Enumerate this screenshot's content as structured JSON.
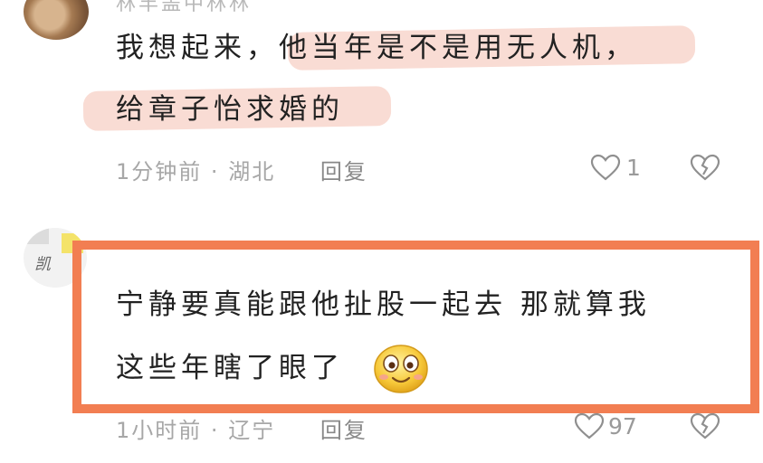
{
  "comments": [
    {
      "author_partial": "林丰盖中林林",
      "text_line1_plain": "我想起来，",
      "text_line1_highlight": "他当年是不是用无人机，",
      "text_line2_highlight": "给章子怡求婚的",
      "time": "1分钟前",
      "separator": "·",
      "location": "湖北",
      "reply_label": "回复",
      "like_count": "1",
      "highlight_color": "#f9dcd4"
    },
    {
      "avatar_scribble": "凯",
      "text_line1": "宁静要真能跟他扯股一起去 那就算我",
      "text_line2": "这些年瞎了眼了",
      "emoji": "smiling-face-emoji",
      "time": "1小时前",
      "separator": "·",
      "location": "辽宁",
      "reply_label": "回复",
      "like_count": "97",
      "frame_color": "#f27e52"
    }
  ],
  "icons": {
    "like": "heart-outline-icon",
    "dislike": "broken-heart-icon"
  },
  "colors": {
    "meta_text": "#a7a7a7",
    "body_text": "#222222"
  }
}
